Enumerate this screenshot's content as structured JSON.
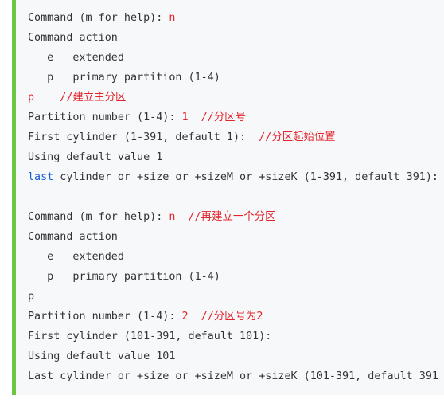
{
  "code": {
    "lines": [
      {
        "parts": [
          {
            "text": "Command (m for help): ",
            "color": "default"
          },
          {
            "text": "n",
            "color": "red"
          }
        ]
      },
      {
        "parts": [
          {
            "text": "Command action",
            "color": "default"
          }
        ]
      },
      {
        "parts": [
          {
            "text": "   e   extended",
            "color": "default"
          }
        ]
      },
      {
        "parts": [
          {
            "text": "   p   primary partition (1-4)",
            "color": "default"
          }
        ]
      },
      {
        "parts": [
          {
            "text": "p    //建立主分区",
            "color": "red"
          }
        ]
      },
      {
        "parts": [
          {
            "text": "Partition number (1-4): ",
            "color": "default"
          },
          {
            "text": "1  //分区号",
            "color": "red"
          }
        ]
      },
      {
        "parts": [
          {
            "text": "First cylinder (1-391, default 1):  ",
            "color": "default"
          },
          {
            "text": "//分区起始位置",
            "color": "red"
          }
        ]
      },
      {
        "parts": [
          {
            "text": "Using default value 1",
            "color": "default"
          }
        ]
      },
      {
        "parts": [
          {
            "text": "last",
            "color": "blue"
          },
          {
            "text": " cylinder or +size or +sizeM or +sizeK (1-391, default 391):",
            "color": "default"
          }
        ]
      },
      {
        "parts": [
          {
            "text": "",
            "color": "default"
          }
        ]
      },
      {
        "parts": [
          {
            "text": "Command (m for help): ",
            "color": "default"
          },
          {
            "text": "n  //再建立一个分区",
            "color": "red"
          }
        ]
      },
      {
        "parts": [
          {
            "text": "Command action",
            "color": "default"
          }
        ]
      },
      {
        "parts": [
          {
            "text": "   e   extended",
            "color": "default"
          }
        ]
      },
      {
        "parts": [
          {
            "text": "   p   primary partition (1-4)",
            "color": "default"
          }
        ]
      },
      {
        "parts": [
          {
            "text": "p",
            "color": "default"
          }
        ]
      },
      {
        "parts": [
          {
            "text": "Partition number (1-4): ",
            "color": "default"
          },
          {
            "text": "2  //分区号为2",
            "color": "red"
          }
        ]
      },
      {
        "parts": [
          {
            "text": "First cylinder (101-391, default 101):",
            "color": "default"
          }
        ]
      },
      {
        "parts": [
          {
            "text": "Using default value 101",
            "color": "default"
          }
        ]
      },
      {
        "parts": [
          {
            "text": "Last cylinder or +size or +sizeM or +sizeK (101-391, default 391",
            "color": "default"
          }
        ]
      }
    ]
  },
  "colors": {
    "accent_bar": "#6cc644",
    "background": "#f6f8fa",
    "text": "#333333",
    "comment_red": "#e3242b",
    "keyword_blue": "#1a5fd1"
  }
}
